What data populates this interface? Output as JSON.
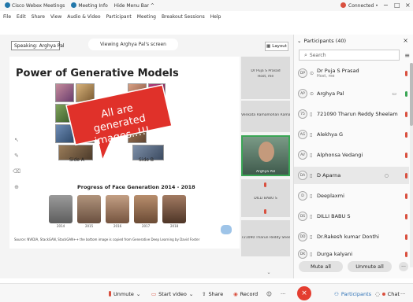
{
  "titlebar": {
    "app_name": "Cisco Webex Meetings",
    "meeting_info": "Meeting Info",
    "hide_menu": "Hide Menu Bar ^",
    "connection": "Connected •",
    "minimize": "−",
    "maximize": "□",
    "close": "×"
  },
  "menubar": [
    "File",
    "Edit",
    "Share",
    "View",
    "Audio & Video",
    "Participant",
    "Meeting",
    "Breakout Sessions",
    "Help"
  ],
  "meeting": {
    "speaking": "Speaking: Arghya Pal",
    "viewing": "Viewing Arghya Pal's screen",
    "layout": "Layout"
  },
  "slide": {
    "title": "Power of Generative Models",
    "callout": "All are generated images..!!!",
    "side_a": "Side A",
    "side_b": "Side B",
    "progress_title": "Progress of Face Generation 2014 - 2018",
    "years": [
      "2014",
      "2015",
      "2016",
      "2017",
      "2018"
    ],
    "source": "Source: NVIDIA, StackGAN, StackGAN++ the bottom image is copied from Generative Deep Learning by David Foster"
  },
  "thumbnails": [
    {
      "name": "Dr Puja S Prasad",
      "sub": "Host, me"
    },
    {
      "name": "Venkata Ramamohan Rama.."
    },
    {
      "name": "Arghya Pal"
    },
    {
      "name": "DILLI BABU S"
    },
    {
      "name": "721090 Tharun Reddy Shee.."
    }
  ],
  "panel": {
    "title": "Participants (40)",
    "search_placeholder": "Search",
    "participants": [
      {
        "initials": "DP",
        "name": "Dr Puja S Prasad",
        "sub": "Host, me"
      },
      {
        "initials": "AP",
        "name": "Arghya Pal"
      },
      {
        "initials": "75",
        "name": "721090 Tharun Reddy Sheelam"
      },
      {
        "initials": "AG",
        "name": "Alekhya G"
      },
      {
        "initials": "AV",
        "name": "Alphonsa Vedangi"
      },
      {
        "initials": "DA",
        "name": "D Aparna"
      },
      {
        "initials": "D",
        "name": "Deeplaxmi"
      },
      {
        "initials": "DS",
        "name": "DILLI BABU S"
      },
      {
        "initials": "DD",
        "name": "Dr.Rakesh kumar Donthi"
      },
      {
        "initials": "DK",
        "name": "Durga kalyani"
      }
    ],
    "mute_all": "Mute all",
    "unmute_all": "Unmute all",
    "more": "···"
  },
  "bottombar": {
    "unmute": "Unmute",
    "start_video": "Start video",
    "share": "Share",
    "record": "Record",
    "participants": "Participants",
    "chat": "Chat",
    "more": "···"
  },
  "colors": {
    "accent_red": "#e43d30",
    "mic_red": "#d9503f",
    "mic_green": "#3aa655",
    "link_blue": "#2a6fb5"
  }
}
